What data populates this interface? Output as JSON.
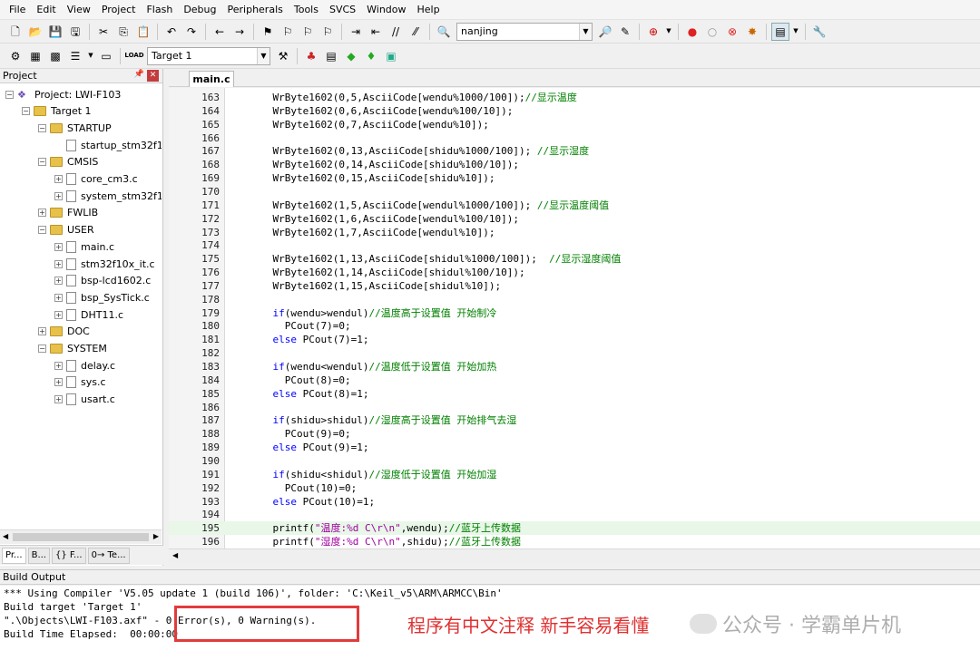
{
  "menu": [
    "File",
    "Edit",
    "View",
    "Project",
    "Flash",
    "Debug",
    "Peripherals",
    "Tools",
    "SVCS",
    "Window",
    "Help"
  ],
  "toolbar1": {
    "find_combo": "nanjing"
  },
  "toolbar2": {
    "target_combo": "Target 1",
    "load_label": "LOAD"
  },
  "project_pane": {
    "title": "Project",
    "tree": [
      {
        "label": "Project: LWI-F103",
        "kind": "project",
        "level": 0,
        "exp": "−"
      },
      {
        "label": "Target 1",
        "kind": "folder",
        "level": 1,
        "exp": "−"
      },
      {
        "label": "STARTUP",
        "kind": "folder",
        "level": 2,
        "exp": "−"
      },
      {
        "label": "startup_stm32f1",
        "kind": "file",
        "level": 3,
        "exp": ""
      },
      {
        "label": "CMSIS",
        "kind": "folder",
        "level": 2,
        "exp": "−"
      },
      {
        "label": "core_cm3.c",
        "kind": "file",
        "level": 3,
        "exp": "+"
      },
      {
        "label": "system_stm32f1",
        "kind": "file",
        "level": 3,
        "exp": "+"
      },
      {
        "label": "FWLIB",
        "kind": "folder",
        "level": 2,
        "exp": "+"
      },
      {
        "label": "USER",
        "kind": "folder",
        "level": 2,
        "exp": "−"
      },
      {
        "label": "main.c",
        "kind": "file",
        "level": 3,
        "exp": "+"
      },
      {
        "label": "stm32f10x_it.c",
        "kind": "file",
        "level": 3,
        "exp": "+"
      },
      {
        "label": "bsp-lcd1602.c",
        "kind": "file",
        "level": 3,
        "exp": "+"
      },
      {
        "label": "bsp_SysTick.c",
        "kind": "file",
        "level": 3,
        "exp": "+"
      },
      {
        "label": "DHT11.c",
        "kind": "file",
        "level": 3,
        "exp": "+"
      },
      {
        "label": "DOC",
        "kind": "folder",
        "level": 2,
        "exp": "+"
      },
      {
        "label": "SYSTEM",
        "kind": "folder",
        "level": 2,
        "exp": "−"
      },
      {
        "label": "delay.c",
        "kind": "file",
        "level": 3,
        "exp": "+"
      },
      {
        "label": "sys.c",
        "kind": "file",
        "level": 3,
        "exp": "+"
      },
      {
        "label": "usart.c",
        "kind": "file",
        "level": 3,
        "exp": "+"
      }
    ],
    "tabs": [
      "Pr...",
      "B...",
      "{} F...",
      "0→ Te..."
    ]
  },
  "editor": {
    "tab": "main.c",
    "lines": [
      {
        "n": "163",
        "parts": [
          [
            "    WrByte1602(0,5,AsciiCode[wendu%1000/100]);",
            ""
          ],
          [
            "//显示温度",
            "cm"
          ]
        ]
      },
      {
        "n": "164",
        "parts": [
          [
            "    WrByte1602(0,6,AsciiCode[wendu%100/10]);",
            ""
          ]
        ]
      },
      {
        "n": "165",
        "parts": [
          [
            "    WrByte1602(0,7,AsciiCode[wendu%10]);",
            ""
          ]
        ]
      },
      {
        "n": "166",
        "parts": []
      },
      {
        "n": "167",
        "parts": [
          [
            "    WrByte1602(0,13,AsciiCode[shidu%1000/100]); ",
            ""
          ],
          [
            "//显示湿度",
            "cm"
          ]
        ]
      },
      {
        "n": "168",
        "parts": [
          [
            "    WrByte1602(0,14,AsciiCode[shidu%100/10]);",
            ""
          ]
        ]
      },
      {
        "n": "169",
        "parts": [
          [
            "    WrByte1602(0,15,AsciiCode[shidu%10]);",
            ""
          ]
        ]
      },
      {
        "n": "170",
        "parts": []
      },
      {
        "n": "171",
        "parts": [
          [
            "    WrByte1602(1,5,AsciiCode[wendul%1000/100]); ",
            ""
          ],
          [
            "//显示温度阈值",
            "cm"
          ]
        ]
      },
      {
        "n": "172",
        "parts": [
          [
            "    WrByte1602(1,6,AsciiCode[wendul%100/10]);",
            ""
          ]
        ]
      },
      {
        "n": "173",
        "parts": [
          [
            "    WrByte1602(1,7,AsciiCode[wendul%10]);",
            ""
          ]
        ]
      },
      {
        "n": "174",
        "parts": []
      },
      {
        "n": "175",
        "parts": [
          [
            "    WrByte1602(1,13,AsciiCode[shidul%1000/100]);  ",
            ""
          ],
          [
            "//显示湿度阈值",
            "cm"
          ]
        ]
      },
      {
        "n": "176",
        "parts": [
          [
            "    WrByte1602(1,14,AsciiCode[shidul%100/10]);",
            ""
          ]
        ]
      },
      {
        "n": "177",
        "parts": [
          [
            "    WrByte1602(1,15,AsciiCode[shidul%10]);",
            ""
          ]
        ]
      },
      {
        "n": "178",
        "parts": []
      },
      {
        "n": "179",
        "parts": [
          [
            "    ",
            ""
          ],
          [
            "if",
            "kw"
          ],
          [
            "(wendu>wendul)",
            ""
          ],
          [
            "//温度高于设置值 开始制冷",
            "cm"
          ]
        ]
      },
      {
        "n": "180",
        "parts": [
          [
            "      PCout(7)=0;",
            ""
          ]
        ]
      },
      {
        "n": "181",
        "parts": [
          [
            "    ",
            ""
          ],
          [
            "else",
            "kw"
          ],
          [
            " PCout(7)=1;",
            ""
          ]
        ]
      },
      {
        "n": "182",
        "parts": []
      },
      {
        "n": "183",
        "parts": [
          [
            "    ",
            ""
          ],
          [
            "if",
            "kw"
          ],
          [
            "(wendu<wendul)",
            ""
          ],
          [
            "//温度低于设置值 开始加热",
            "cm"
          ]
        ]
      },
      {
        "n": "184",
        "parts": [
          [
            "      PCout(8)=0;",
            ""
          ]
        ]
      },
      {
        "n": "185",
        "parts": [
          [
            "    ",
            ""
          ],
          [
            "else",
            "kw"
          ],
          [
            " PCout(8)=1;",
            ""
          ]
        ]
      },
      {
        "n": "186",
        "parts": []
      },
      {
        "n": "187",
        "parts": [
          [
            "    ",
            ""
          ],
          [
            "if",
            "kw"
          ],
          [
            "(shidu>shidul)",
            ""
          ],
          [
            "//湿度高于设置值 开始排气去湿",
            "cm"
          ]
        ]
      },
      {
        "n": "188",
        "parts": [
          [
            "      PCout(9)=0;",
            ""
          ]
        ]
      },
      {
        "n": "189",
        "parts": [
          [
            "    ",
            ""
          ],
          [
            "else",
            "kw"
          ],
          [
            " PCout(9)=1;",
            ""
          ]
        ]
      },
      {
        "n": "190",
        "parts": []
      },
      {
        "n": "191",
        "parts": [
          [
            "    ",
            ""
          ],
          [
            "if",
            "kw"
          ],
          [
            "(shidu<shidul)",
            ""
          ],
          [
            "//湿度低于设置值 开始加湿",
            "cm"
          ]
        ]
      },
      {
        "n": "192",
        "parts": [
          [
            "      PCout(10)=0;",
            ""
          ]
        ]
      },
      {
        "n": "193",
        "parts": [
          [
            "    ",
            ""
          ],
          [
            "else",
            "kw"
          ],
          [
            " PCout(10)=1;",
            ""
          ]
        ]
      },
      {
        "n": "194",
        "parts": []
      },
      {
        "n": "195",
        "hl": true,
        "parts": [
          [
            "    printf(",
            ""
          ],
          [
            "\"温度:%d C\\r\\n\"",
            "str"
          ],
          [
            ",wendu);",
            ""
          ],
          [
            "//蓝牙上传数据",
            "cm"
          ]
        ]
      },
      {
        "n": "196",
        "parts": [
          [
            "    printf(",
            ""
          ],
          [
            "\"湿度:%d C\\r\\n\"",
            "str"
          ],
          [
            ",shidu);",
            ""
          ],
          [
            "//蓝牙上传数据",
            "cm"
          ]
        ]
      }
    ]
  },
  "build": {
    "title": "Build Output",
    "lines": [
      "*** Using Compiler 'V5.05 update 1 (build 106)', folder: 'C:\\Keil_v5\\ARM\\ARMCC\\Bin'",
      "Build target 'Target 1'",
      "\".\\Objects\\LWI-F103.axf\" - 0 Error(s), 0 Warning(s).",
      "Build Time Elapsed:  00:00:00"
    ],
    "annotation": "程序有中文注释 新手容易看懂",
    "watermark": "公众号 · 学霸单片机"
  },
  "colors": {
    "keyword": "#0000ff",
    "comment": "#008000",
    "string": "#a000a0",
    "annotation": "#e03030"
  }
}
